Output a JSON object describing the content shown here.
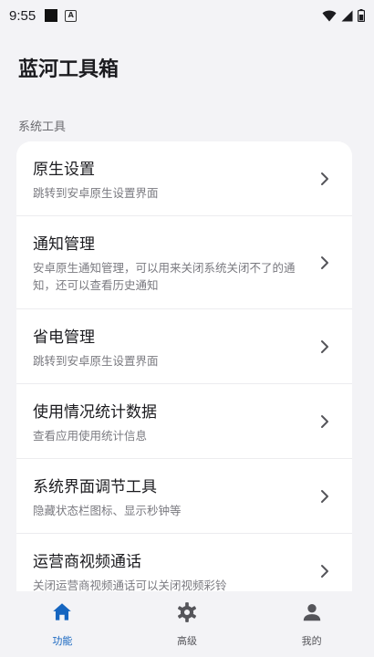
{
  "status_bar": {
    "time": "9:55",
    "notif_icon": "A"
  },
  "app": {
    "title": "蓝河工具箱"
  },
  "section": {
    "label": "系统工具"
  },
  "items": [
    {
      "title": "原生设置",
      "desc": "跳转到安卓原生设置界面"
    },
    {
      "title": "通知管理",
      "desc": "安卓原生通知管理，可以用来关闭系统关闭不了的通知，还可以查看历史通知"
    },
    {
      "title": "省电管理",
      "desc": "跳转到安卓原生设置界面"
    },
    {
      "title": "使用情况统计数据",
      "desc": "查看应用使用统计信息"
    },
    {
      "title": "系统界面调节工具",
      "desc": "隐藏状态栏图标、显示秒钟等"
    },
    {
      "title": "运营商视频通话",
      "desc": "关闭运营商视频通话可以关闭视频彩铃"
    }
  ],
  "nav": [
    {
      "label": "功能",
      "icon": "home-icon"
    },
    {
      "label": "高级",
      "icon": "gear-icon"
    },
    {
      "label": "我的",
      "icon": "person-icon"
    }
  ],
  "colors": {
    "accent": "#1565c0",
    "background": "#f3f3f6",
    "card": "#ffffff"
  }
}
